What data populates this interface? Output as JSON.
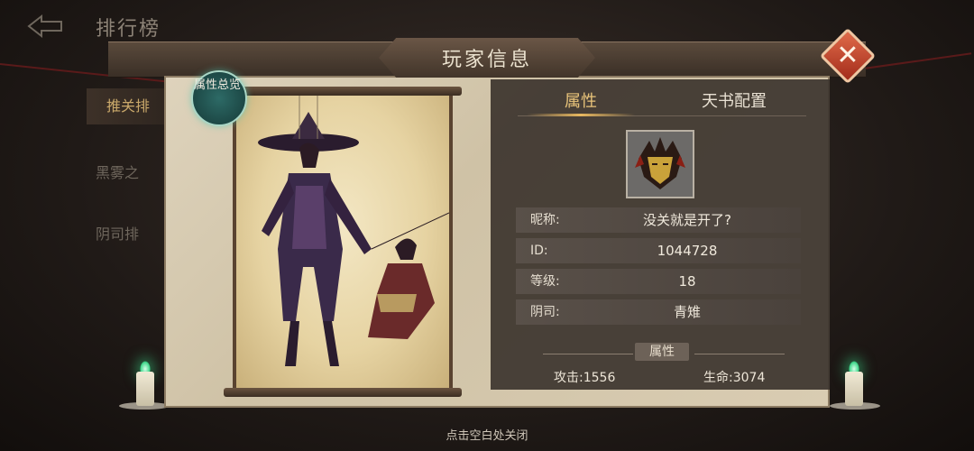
{
  "background": {
    "title": "排行榜",
    "tabs": [
      {
        "label": "推关排"
      },
      {
        "label": "黑雾之"
      },
      {
        "label": "阴司排"
      }
    ]
  },
  "panel": {
    "title": "玩家信息",
    "badge_label": "属性总览",
    "close_icon": "close-x-icon"
  },
  "tabs": [
    {
      "label": "属性",
      "active": true
    },
    {
      "label": "天书配置",
      "active": false
    }
  ],
  "player": {
    "rows": [
      {
        "label": "昵称:",
        "value": "没关就是开了?"
      },
      {
        "label": "ID:",
        "value": "1044728"
      },
      {
        "label": "等级:",
        "value": "18"
      },
      {
        "label": "阴司:",
        "value": "青雉"
      }
    ]
  },
  "attributes": {
    "section_title": "属性",
    "attack": "攻击:1556",
    "health": "生命:3074"
  },
  "hint": "点击空白处关闭",
  "colors": {
    "accent": "#e8c37a",
    "close": "#c0432a",
    "candle_flame": "#3ed68a"
  }
}
